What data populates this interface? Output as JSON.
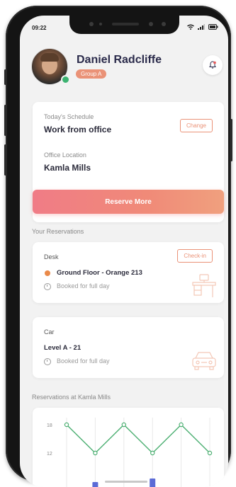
{
  "status_bar": {
    "time": "09:22"
  },
  "profile": {
    "name": "Daniel Radcliffe",
    "group": "Group A",
    "online": true
  },
  "schedule": {
    "today_label": "Today's Schedule",
    "today_value": "Work from office",
    "change_label": "Change",
    "location_label": "Office Location",
    "location_value": "Kamla Mills"
  },
  "reserve_button": {
    "label": "Reserve More"
  },
  "reservations": {
    "section_title": "Your Reservations",
    "desk": {
      "title": "Desk",
      "location": "Ground Floor - Orange 213",
      "booked": "Booked for full day",
      "checkin_label": "Check-in"
    },
    "car": {
      "title": "Car",
      "location": "Level A - 21",
      "booked": "Booked for full day"
    }
  },
  "chart_section": {
    "title": "Reservations at Kamla Mills"
  },
  "chart_data": {
    "type": "line",
    "ytick_labels": [
      "18",
      "12"
    ],
    "series": [
      {
        "values": [
          18,
          12,
          18,
          12,
          18,
          12
        ]
      }
    ],
    "bars": [
      6,
      8
    ]
  },
  "colors": {
    "accent": "#ea9277",
    "accent_gradient_start": "#f07c86",
    "accent_gradient_end": "#f0a07e",
    "line": "#4caf72",
    "bar": "#5b6bd6",
    "name": "#2a2a4a"
  }
}
